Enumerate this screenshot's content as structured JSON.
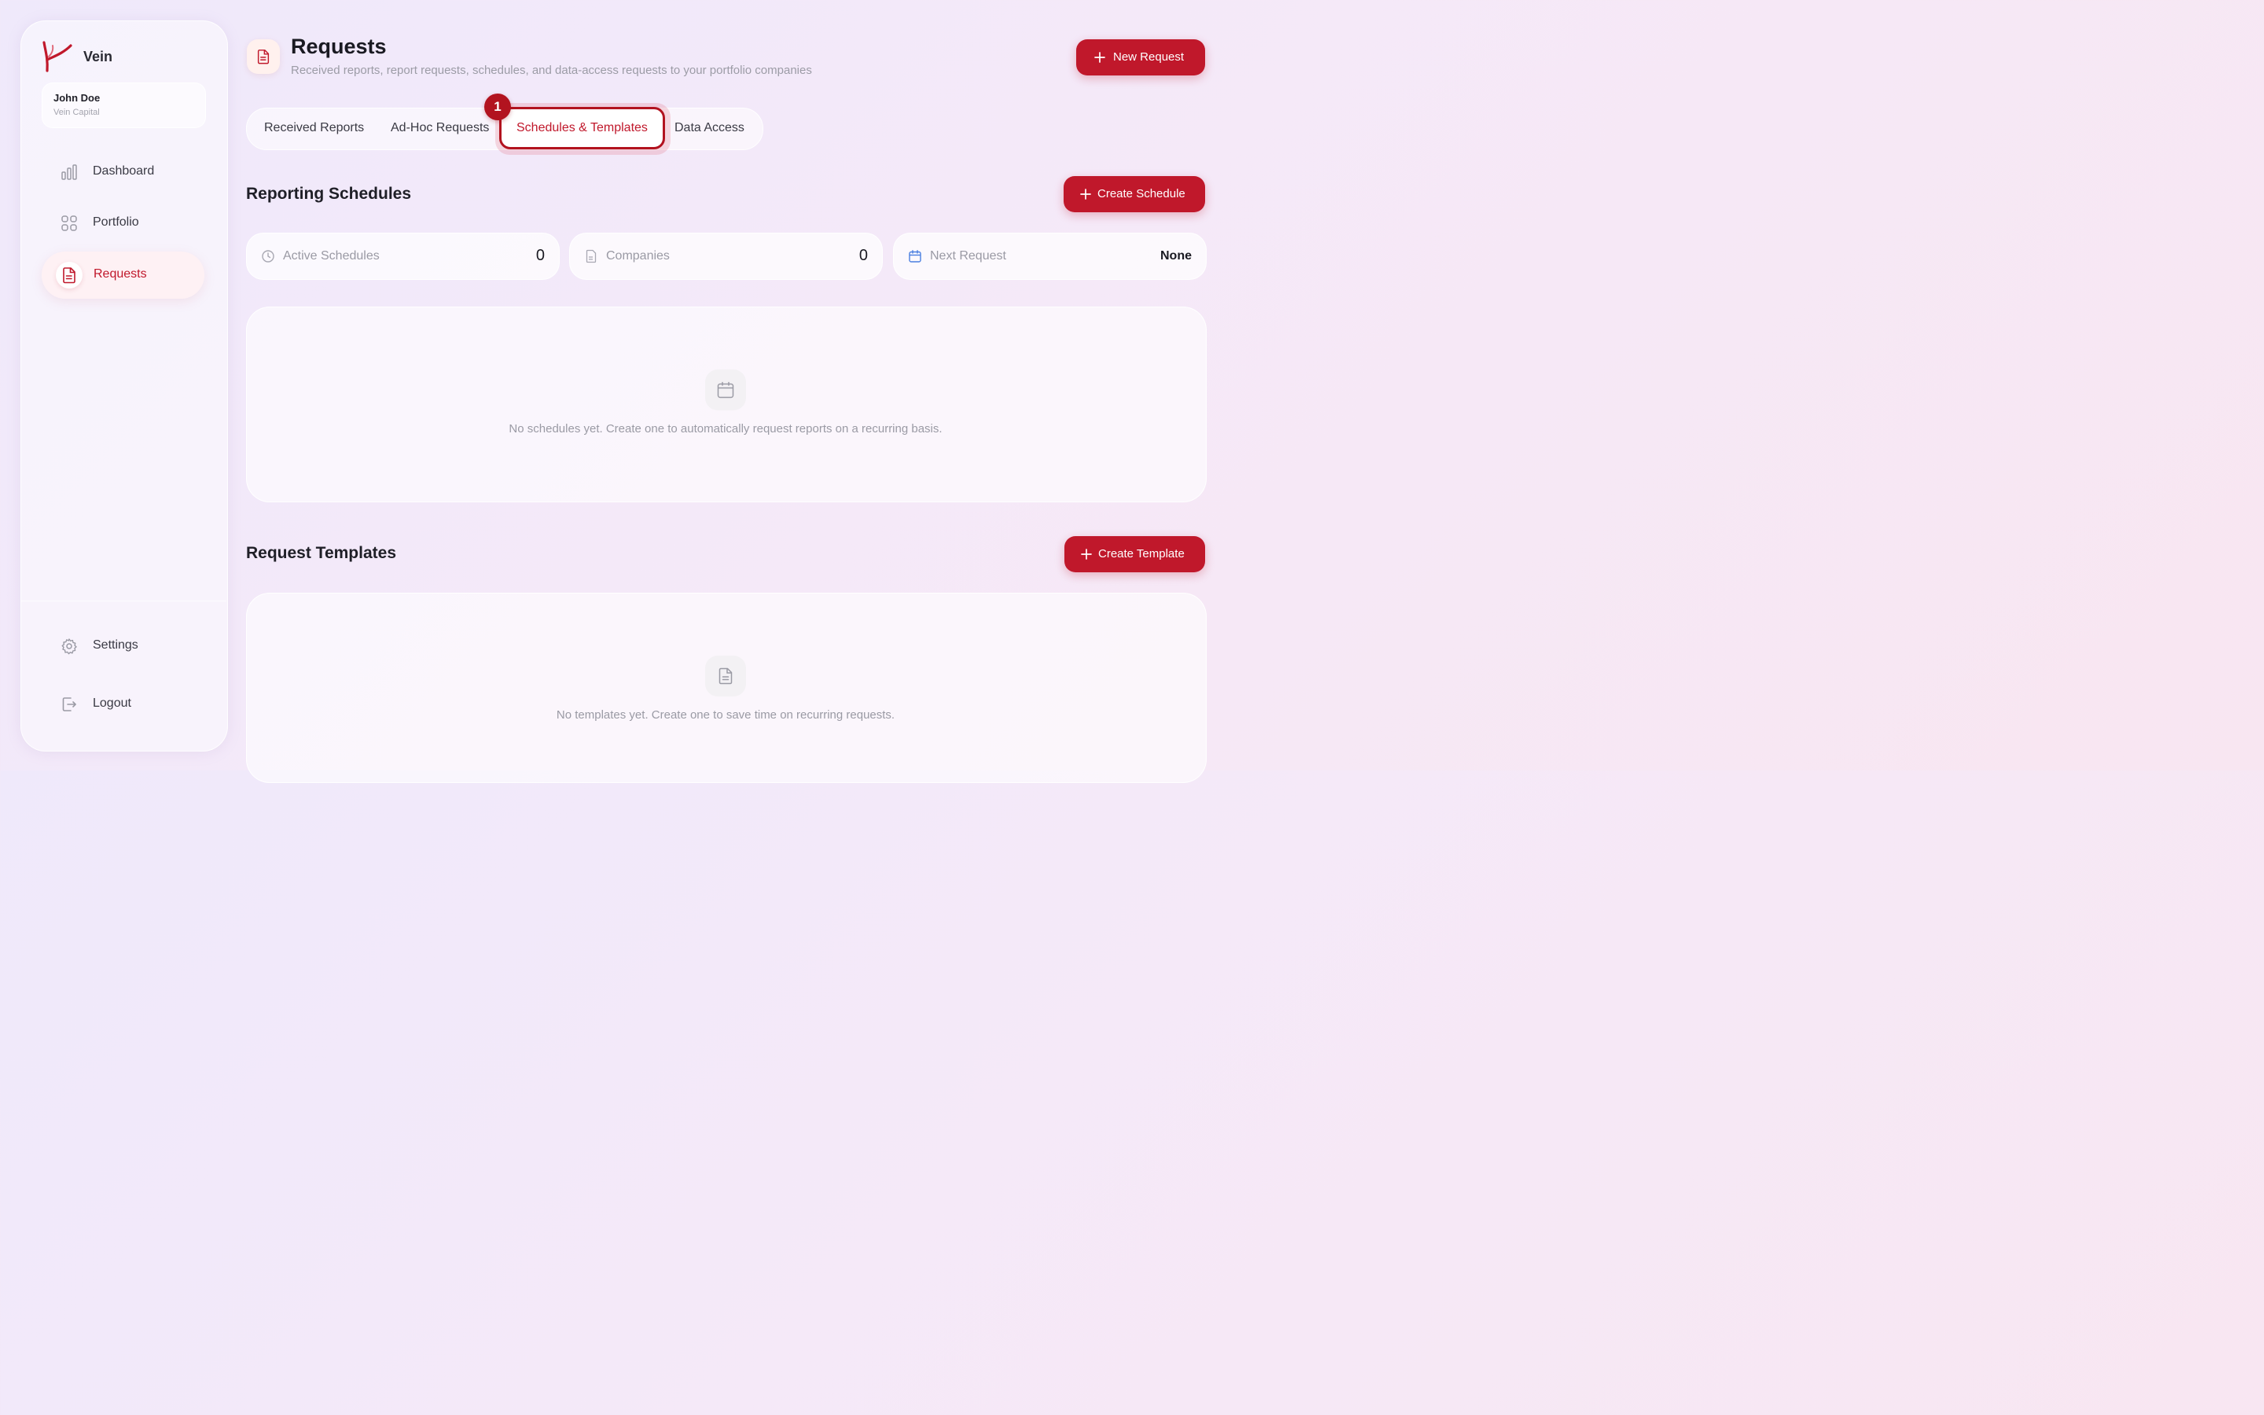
{
  "app": {
    "brand": "Vein"
  },
  "user": {
    "name": "John Doe",
    "org": "Vein Capital"
  },
  "nav": {
    "items": [
      {
        "label": "Dashboard",
        "icon": "bar-chart-icon"
      },
      {
        "label": "Portfolio",
        "icon": "grid-icon"
      },
      {
        "label": "Requests",
        "icon": "document-icon",
        "active": true
      }
    ],
    "bottom": [
      {
        "label": "Settings",
        "icon": "gear-icon"
      },
      {
        "label": "Logout",
        "icon": "logout-icon"
      }
    ]
  },
  "header": {
    "title": "Requests",
    "subtitle": "Received reports, report requests, schedules, and data-access requests to your portfolio companies",
    "new_request_label": "New Request"
  },
  "tabs": [
    {
      "label": "Received Reports"
    },
    {
      "label": "Ad-Hoc Requests"
    },
    {
      "label": "Schedules & Templates",
      "active": true
    },
    {
      "label": "Data Access"
    }
  ],
  "step_badge": "1",
  "schedules": {
    "title": "Reporting Schedules",
    "create_label": "Create Schedule",
    "stats": [
      {
        "label": "Active Schedules",
        "value": "0",
        "icon": "clock-icon"
      },
      {
        "label": "Companies",
        "value": "0",
        "icon": "document-icon"
      },
      {
        "label": "Next Request",
        "value": "None",
        "icon": "calendar-icon"
      }
    ],
    "empty_text": "No schedules yet. Create one to automatically request reports on a recurring basis."
  },
  "templates": {
    "title": "Request Templates",
    "create_label": "Create Template",
    "empty_text": "No templates yet. Create one to save time on recurring requests."
  },
  "colors": {
    "accent": "#c0182b",
    "accent_dark": "#b2131f",
    "muted_text": "#9a9aa4",
    "calendar_icon": "#4a7fe0"
  }
}
